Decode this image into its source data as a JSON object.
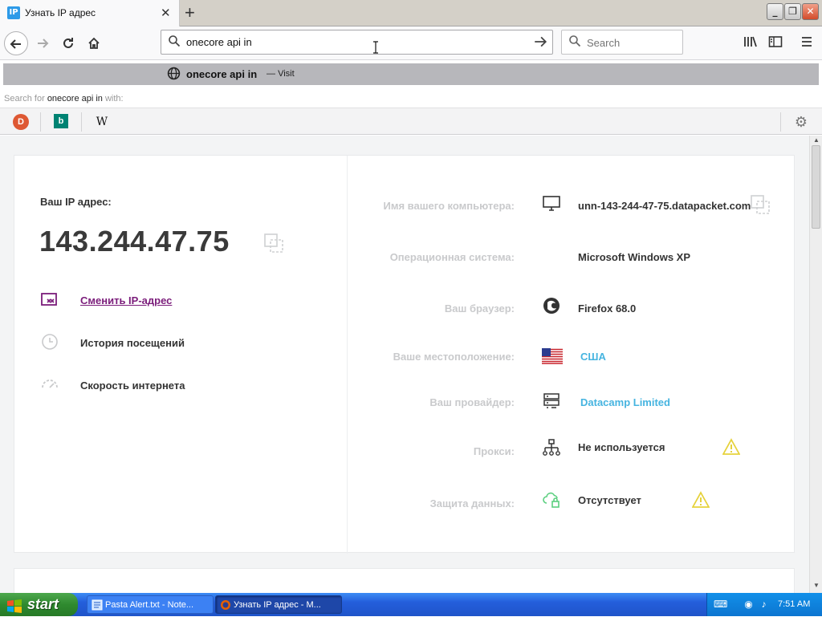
{
  "browser": {
    "tab": {
      "badge": "IP",
      "title": "Узнать IP адрес",
      "close": "✕"
    },
    "new_tab": "+",
    "window_buttons": {
      "minimize": "_",
      "restore": "❐",
      "close": "✕"
    },
    "url_value": "onecore api in",
    "search_placeholder": "Search"
  },
  "autocomplete": {
    "suggestion": "onecore api in",
    "separator": "—",
    "action": "Visit",
    "search_for_prefix": "Search for",
    "search_for_query": "onecore api in",
    "search_for_suffix": "with:",
    "engines": [
      "DuckDuckGo",
      "Bing",
      "Wikipedia"
    ]
  },
  "page": {
    "ip_label": "Ваш IP адрес:",
    "ip_value": "143.244.47.75",
    "links": {
      "change_ip": "Сменить IP-адрес",
      "history": "История посещений",
      "speed": "Скорость интернета"
    },
    "info": {
      "computer_name": {
        "label": "Имя вашего компьютера:",
        "value": "unn-143-244-47-75.datapacket.com"
      },
      "os": {
        "label": "Операционная система:",
        "value": "Microsoft Windows XP"
      },
      "browser": {
        "label": "Ваш браузер:",
        "value": "Firefox 68.0"
      },
      "location": {
        "label": "Ваше местоположение:",
        "value": "США"
      },
      "provider": {
        "label": "Ваш провайдер:",
        "value": "Datacamp Limited"
      },
      "proxy": {
        "label": "Прокси:",
        "value": "Не используется"
      },
      "data_protection": {
        "label": "Защита данных:",
        "value": "Отсутствует"
      }
    },
    "colors": {
      "accent_purple": "#7b1d7b",
      "link_blue": "#46b4e0",
      "warning": "#e6d23c",
      "label_gray": "#c9cacc"
    }
  },
  "taskbar": {
    "start": "start",
    "tasks": [
      {
        "label": "Pasta Alert.txt - Note..."
      },
      {
        "label": "Узнать IP адрес - M..."
      }
    ],
    "clock": "7:51 AM"
  }
}
